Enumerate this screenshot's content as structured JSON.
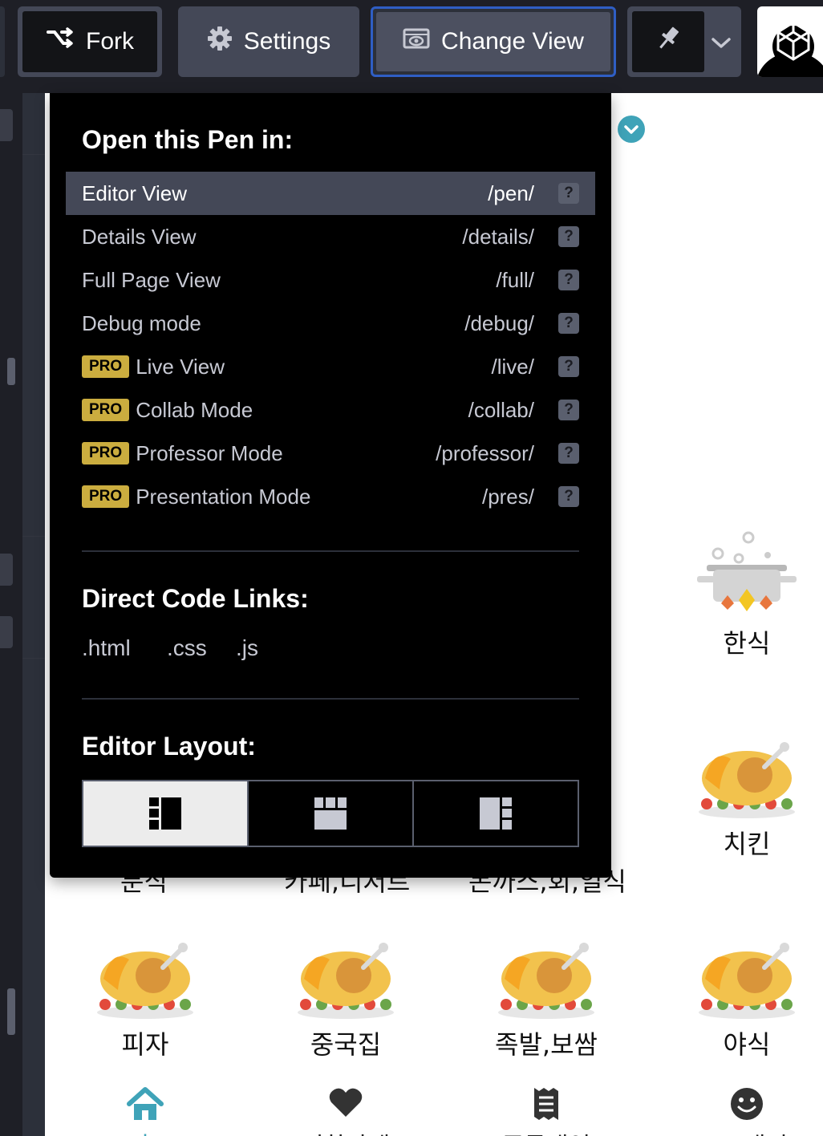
{
  "toolbar": {
    "fork_label": "Fork",
    "settings_label": "Settings",
    "change_view_label": "Change View",
    "accent_color": "#2f5ec4"
  },
  "dropdown": {
    "open_heading": "Open this Pen in:",
    "views": [
      {
        "name": "Editor View",
        "path": "/pen/",
        "pro": false,
        "active": true
      },
      {
        "name": "Details View",
        "path": "/details/",
        "pro": false,
        "active": false
      },
      {
        "name": "Full Page View",
        "path": "/full/",
        "pro": false,
        "active": false
      },
      {
        "name": "Debug mode",
        "path": "/debug/",
        "pro": false,
        "active": false
      },
      {
        "name": "Live View",
        "path": "/live/",
        "pro": true,
        "active": false
      },
      {
        "name": "Collab Mode",
        "path": "/collab/",
        "pro": true,
        "active": false
      },
      {
        "name": "Professor Mode",
        "path": "/professor/",
        "pro": true,
        "active": false
      },
      {
        "name": "Presentation Mode",
        "path": "/pres/",
        "pro": true,
        "active": false
      }
    ],
    "pro_badge": "PRO",
    "help_glyph": "?",
    "code_heading": "Direct Code Links:",
    "code_links": [
      ".html",
      ".css",
      ".js"
    ],
    "layout_heading": "Editor Layout:",
    "layout_options": [
      "layout-left-icon",
      "layout-top-icon",
      "layout-right-icon"
    ],
    "selected_layout": "layout-left-icon",
    "pro_color": "#cbad3f"
  },
  "preview": {
    "categories": [
      {
        "label": "한식",
        "icon": "pot-icon"
      },
      {
        "label": "치킨",
        "icon": "chicken-icon"
      },
      {
        "label": "피자",
        "icon": "chicken-icon"
      },
      {
        "label": "중국집",
        "icon": "chicken-icon"
      },
      {
        "label": "족발,보쌈",
        "icon": "chicken-icon"
      },
      {
        "label": "야식",
        "icon": "chicken-icon"
      }
    ],
    "hidden_row_labels": [
      "분식",
      "카페,디저트",
      "돈까스,회,일식"
    ],
    "tabs": [
      {
        "label": "홈",
        "icon": "home-icon",
        "active": true
      },
      {
        "label": "찜한가게",
        "icon": "heart-icon",
        "active": false
      },
      {
        "label": "주문내역",
        "icon": "receipt-icon",
        "active": false
      },
      {
        "label": "my배민",
        "icon": "smile-icon",
        "active": false
      }
    ],
    "active_tab_color": "#3fa3b8"
  }
}
